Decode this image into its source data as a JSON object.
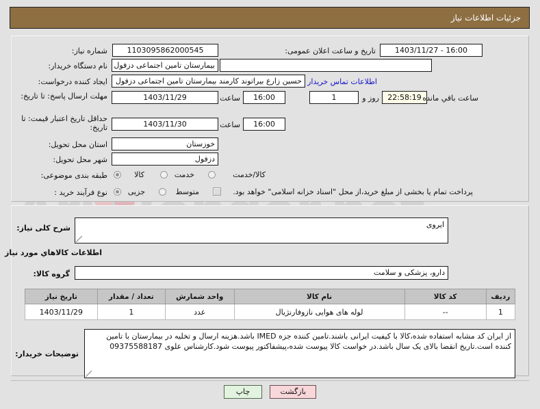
{
  "header": {
    "title": "جزئیات اطلاعات نیاز"
  },
  "watermark": {
    "text": "AriaTender.net"
  },
  "form": {
    "need_number": {
      "label": "شماره نیاز:",
      "value": "1103095862000545"
    },
    "public_announce": {
      "label": "تاریخ و ساعت اعلان عمومی:",
      "value": "16:00 - 1403/11/27"
    },
    "buyer_org": {
      "label": "نام دستگاه خریدار:",
      "value": "بیمارستان تامین اجتماعی دزفول"
    },
    "buyer_org_extra": {
      "value": ""
    },
    "requester": {
      "label": "ایجاد کننده درخواست:",
      "value": "حسین زارع بیراتوند کارمند بیمارستان تامین اجتماعی دزفول"
    },
    "contact_link": {
      "label": "اطلاعات تماس خریدار"
    },
    "response_deadline": {
      "label": "مهلت ارسال پاسخ: تا تاریخ:",
      "date": "1403/11/29",
      "time_label": "ساعت",
      "time": "16:00",
      "days": "1",
      "days_label": "روز و",
      "remaining": "22:58:19",
      "remaining_label": "ساعت باقي مانده"
    },
    "price_validity": {
      "label": "حداقل تاریخ اعتبار قیمت: تا تاریخ:",
      "date": "1403/11/30",
      "time_label": "ساعت",
      "time": "16:00"
    },
    "delivery_province": {
      "label": "استان محل تحویل:",
      "value": "خوزستان"
    },
    "delivery_city": {
      "label": "شهر محل تحویل:",
      "value": "دزفول"
    },
    "classification": {
      "label": "طبقه بندی موضوعی:",
      "options": [
        {
          "label": "کالا",
          "selected": true
        },
        {
          "label": "خدمت",
          "selected": false
        },
        {
          "label": "کالا/خدمت",
          "selected": false
        }
      ]
    },
    "purchase_type": {
      "label": "نوع فرآیند خرید :",
      "options": [
        {
          "label": "جزیی",
          "selected": true
        },
        {
          "label": "متوسط",
          "selected": false
        }
      ],
      "checkbox_label": "پرداخت تمام یا بخشی از مبلغ خرید،از محل \"اسناد خزانه اسلامی\" خواهد بود.",
      "checkbox_checked": false
    },
    "need_summary": {
      "label": "شرح کلی نیاز:",
      "value": "ایروی"
    },
    "goods_section_title": "اطلاعات کالاهاي مورد نیاز",
    "goods_group": {
      "label": "گروه کالا:",
      "value": "دارو، پزشکی و سلامت"
    },
    "buyer_notes": {
      "label": "توضیحات خریدار:",
      "value": "از ایران کد مشابه استفاده شده،کالا با کیفیت ایرانی باشند.تامین کننده جزه IMED باشد.هزینه ارسال و تخلیه در بیمارستان با تامین کننده است.تاریخ انقضا بالای یک سال باشد.در خواست کالا پیوست شده،پیشفاکتور پیوست شود.کارشناس علوی 09375588187"
    }
  },
  "goods_table": {
    "columns": [
      "ردیف",
      "کد کالا",
      "نام کالا",
      "واحد شمارش",
      "تعداد / مقدار",
      "تاریخ نیاز"
    ],
    "rows": [
      {
        "row": "1",
        "code": "--",
        "name": "لوله های هوایی نازوفارنژیال",
        "unit": "عدد",
        "qty": "1",
        "need_date": "1403/11/29"
      }
    ]
  },
  "buttons": {
    "back": "بازگشت",
    "print": "چاپ"
  }
}
